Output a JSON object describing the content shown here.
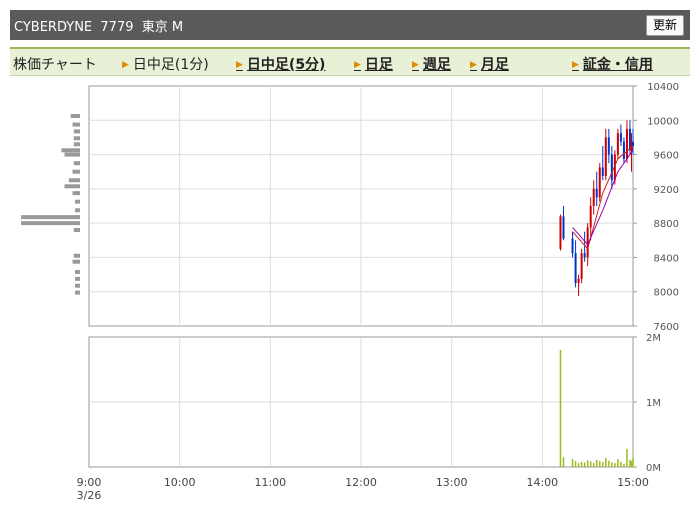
{
  "header": {
    "ticker": "CYBERDYNE  7779  東京 M",
    "refresh_label": "更新"
  },
  "tabs": [
    {
      "label": "株価チャート",
      "arrow": false,
      "link": false
    },
    {
      "label": "日中足(1分)",
      "arrow": true,
      "link": false
    },
    {
      "label": "日中足(5分)",
      "arrow": true,
      "link": true
    },
    {
      "label": "日足",
      "arrow": true,
      "link": true
    },
    {
      "label": "週足",
      "arrow": true,
      "link": true
    },
    {
      "label": "月足",
      "arrow": true,
      "link": true
    },
    {
      "label": "証金・信用",
      "arrow": true,
      "link": true
    }
  ],
  "chart_data": {
    "type": "candlestick",
    "session_date": "3/26",
    "x_ticks": [
      "9:00",
      "10:00",
      "11:00",
      "12:00",
      "13:00",
      "14:00",
      "15:00"
    ],
    "price_axis": {
      "ylim": [
        7600,
        10400
      ],
      "ticks": [
        7600,
        8000,
        8400,
        8800,
        9200,
        9600,
        10000,
        10400
      ]
    },
    "volume_axis": {
      "ylim": [
        0,
        2000000
      ],
      "tick_labels": [
        "0M",
        "1M",
        "2M"
      ],
      "ticks": [
        0,
        1000000,
        2000000
      ]
    },
    "price_bars": [
      {
        "t": "14:12",
        "o": 8500,
        "h": 8900,
        "l": 8480,
        "c": 8880
      },
      {
        "t": "14:14",
        "o": 8880,
        "h": 9000,
        "l": 8600,
        "c": 8620
      },
      {
        "t": "14:20",
        "o": 8620,
        "h": 8700,
        "l": 8400,
        "c": 8450
      },
      {
        "t": "14:22",
        "o": 8450,
        "h": 8600,
        "l": 8050,
        "c": 8100
      },
      {
        "t": "14:24",
        "o": 8100,
        "h": 8200,
        "l": 7950,
        "c": 8150
      },
      {
        "t": "14:26",
        "o": 8150,
        "h": 8500,
        "l": 8100,
        "c": 8450
      },
      {
        "t": "14:28",
        "o": 8450,
        "h": 8700,
        "l": 8350,
        "c": 8400
      },
      {
        "t": "14:30",
        "o": 8400,
        "h": 8800,
        "l": 8300,
        "c": 8750
      },
      {
        "t": "14:32",
        "o": 8750,
        "h": 9100,
        "l": 8600,
        "c": 9000
      },
      {
        "t": "14:34",
        "o": 9000,
        "h": 9300,
        "l": 8900,
        "c": 9200
      },
      {
        "t": "14:36",
        "o": 9200,
        "h": 9400,
        "l": 9000,
        "c": 9100
      },
      {
        "t": "14:38",
        "o": 9100,
        "h": 9500,
        "l": 9050,
        "c": 9450
      },
      {
        "t": "14:40",
        "o": 9450,
        "h": 9700,
        "l": 9300,
        "c": 9350
      },
      {
        "t": "14:42",
        "o": 9350,
        "h": 9900,
        "l": 9300,
        "c": 9800
      },
      {
        "t": "14:44",
        "o": 9800,
        "h": 9900,
        "l": 9500,
        "c": 9600
      },
      {
        "t": "14:46",
        "o": 9600,
        "h": 9700,
        "l": 9200,
        "c": 9300
      },
      {
        "t": "14:48",
        "o": 9300,
        "h": 9650,
        "l": 9250,
        "c": 9600
      },
      {
        "t": "14:50",
        "o": 9600,
        "h": 9900,
        "l": 9550,
        "c": 9850
      },
      {
        "t": "14:52",
        "o": 9850,
        "h": 9950,
        "l": 9700,
        "c": 9750
      },
      {
        "t": "14:54",
        "o": 9750,
        "h": 9800,
        "l": 9500,
        "c": 9550
      },
      {
        "t": "14:56",
        "o": 9550,
        "h": 10000,
        "l": 9500,
        "c": 9900
      },
      {
        "t": "14:58",
        "o": 9900,
        "h": 10000,
        "l": 9600,
        "c": 9650
      },
      {
        "t": "14:59",
        "o": 9650,
        "h": 9850,
        "l": 9400,
        "c": 9750
      },
      {
        "t": "15:00",
        "o": 9750,
        "h": 9900,
        "l": 9600,
        "c": 9700
      }
    ],
    "moving_averages": [
      {
        "color": "#cc2222",
        "values": [
          [
            "14:20",
            8700
          ],
          [
            "14:30",
            8500
          ],
          [
            "14:40",
            9150
          ],
          [
            "14:50",
            9550
          ],
          [
            "15:00",
            9700
          ]
        ]
      },
      {
        "color": "#9a00b0",
        "values": [
          [
            "14:20",
            8750
          ],
          [
            "14:30",
            8550
          ],
          [
            "14:40",
            8950
          ],
          [
            "14:50",
            9400
          ],
          [
            "15:00",
            9650
          ]
        ]
      }
    ],
    "volume_bars": [
      {
        "t": "14:12",
        "v": 1800000
      },
      {
        "t": "14:14",
        "v": 150000
      },
      {
        "t": "14:20",
        "v": 120000
      },
      {
        "t": "14:22",
        "v": 90000
      },
      {
        "t": "14:24",
        "v": 60000
      },
      {
        "t": "14:26",
        "v": 80000
      },
      {
        "t": "14:28",
        "v": 70000
      },
      {
        "t": "14:30",
        "v": 100000
      },
      {
        "t": "14:32",
        "v": 85000
      },
      {
        "t": "14:34",
        "v": 60000
      },
      {
        "t": "14:36",
        "v": 110000
      },
      {
        "t": "14:38",
        "v": 90000
      },
      {
        "t": "14:40",
        "v": 75000
      },
      {
        "t": "14:42",
        "v": 140000
      },
      {
        "t": "14:44",
        "v": 95000
      },
      {
        "t": "14:46",
        "v": 70000
      },
      {
        "t": "14:48",
        "v": 60000
      },
      {
        "t": "14:50",
        "v": 120000
      },
      {
        "t": "14:52",
        "v": 80000
      },
      {
        "t": "14:54",
        "v": 50000
      },
      {
        "t": "14:56",
        "v": 280000
      },
      {
        "t": "14:58",
        "v": 110000
      },
      {
        "t": "14:59",
        "v": 90000
      },
      {
        "t": "15:00",
        "v": 140000
      }
    ],
    "volume_by_price": [
      {
        "price": 10050,
        "rel": 0.15
      },
      {
        "price": 9950,
        "rel": 0.12
      },
      {
        "price": 9870,
        "rel": 0.1
      },
      {
        "price": 9790,
        "rel": 0.1
      },
      {
        "price": 9720,
        "rel": 0.1
      },
      {
        "price": 9650,
        "rel": 0.3
      },
      {
        "price": 9600,
        "rel": 0.25
      },
      {
        "price": 9500,
        "rel": 0.1
      },
      {
        "price": 9400,
        "rel": 0.12
      },
      {
        "price": 9300,
        "rel": 0.18
      },
      {
        "price": 9230,
        "rel": 0.25
      },
      {
        "price": 9150,
        "rel": 0.12
      },
      {
        "price": 9050,
        "rel": 0.08
      },
      {
        "price": 8950,
        "rel": 0.08
      },
      {
        "price": 8870,
        "rel": 0.95
      },
      {
        "price": 8800,
        "rel": 0.95
      },
      {
        "price": 8720,
        "rel": 0.1
      },
      {
        "price": 8420,
        "rel": 0.1
      },
      {
        "price": 8350,
        "rel": 0.12
      },
      {
        "price": 8230,
        "rel": 0.08
      },
      {
        "price": 8150,
        "rel": 0.08
      },
      {
        "price": 8070,
        "rel": 0.08
      },
      {
        "price": 7990,
        "rel": 0.08
      }
    ],
    "colors": {
      "up": "#cc0000",
      "down": "#0033cc",
      "volume": "#99bb22",
      "vbp": "#999999",
      "grid": "#dddddd",
      "frame": "#999999"
    }
  }
}
